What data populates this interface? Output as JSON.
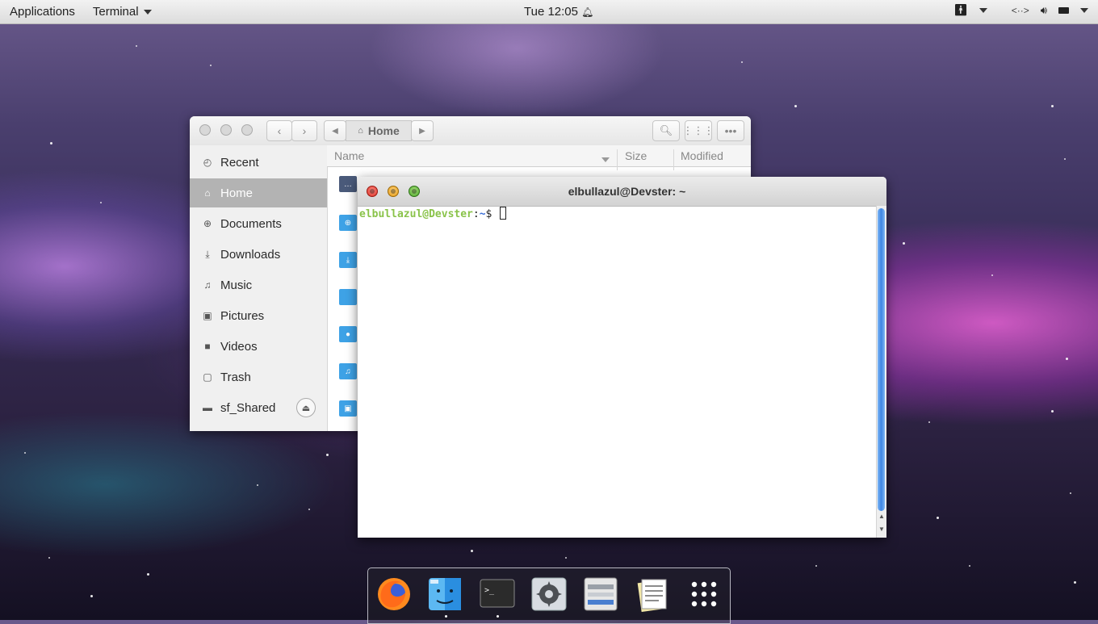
{
  "topbar": {
    "applications": "Applications",
    "terminal_menu": "Terminal",
    "clock": "Tue 12:05",
    "tray_icons": [
      "accessibility-icon",
      "network-icon",
      "volume-icon",
      "battery-icon",
      "system-menu-icon"
    ]
  },
  "file_manager": {
    "breadcrumb": "Home",
    "columns": {
      "name": "Name",
      "size": "Size",
      "modified": "Modified"
    },
    "sidebar": [
      {
        "label": "Recent",
        "icon": "clock-icon"
      },
      {
        "label": "Home",
        "icon": "home-icon",
        "selected": true
      },
      {
        "label": "Documents",
        "icon": "documents-icon"
      },
      {
        "label": "Downloads",
        "icon": "download-icon"
      },
      {
        "label": "Music",
        "icon": "music-icon"
      },
      {
        "label": "Pictures",
        "icon": "pictures-icon"
      },
      {
        "label": "Videos",
        "icon": "videos-icon"
      },
      {
        "label": "Trash",
        "icon": "trash-icon"
      },
      {
        "label": "sf_Shared",
        "icon": "drive-icon"
      }
    ]
  },
  "terminal": {
    "title": "elbullazul@Devster: ~",
    "prompt_user": "elbullazul@Devster",
    "prompt_path": "~",
    "prompt_symbol": "$"
  },
  "dock": {
    "apps": [
      "firefox-icon",
      "finder-icon",
      "terminal-icon",
      "settings-icon",
      "file-manager-icon",
      "text-editor-icon",
      "app-grid-icon"
    ]
  }
}
